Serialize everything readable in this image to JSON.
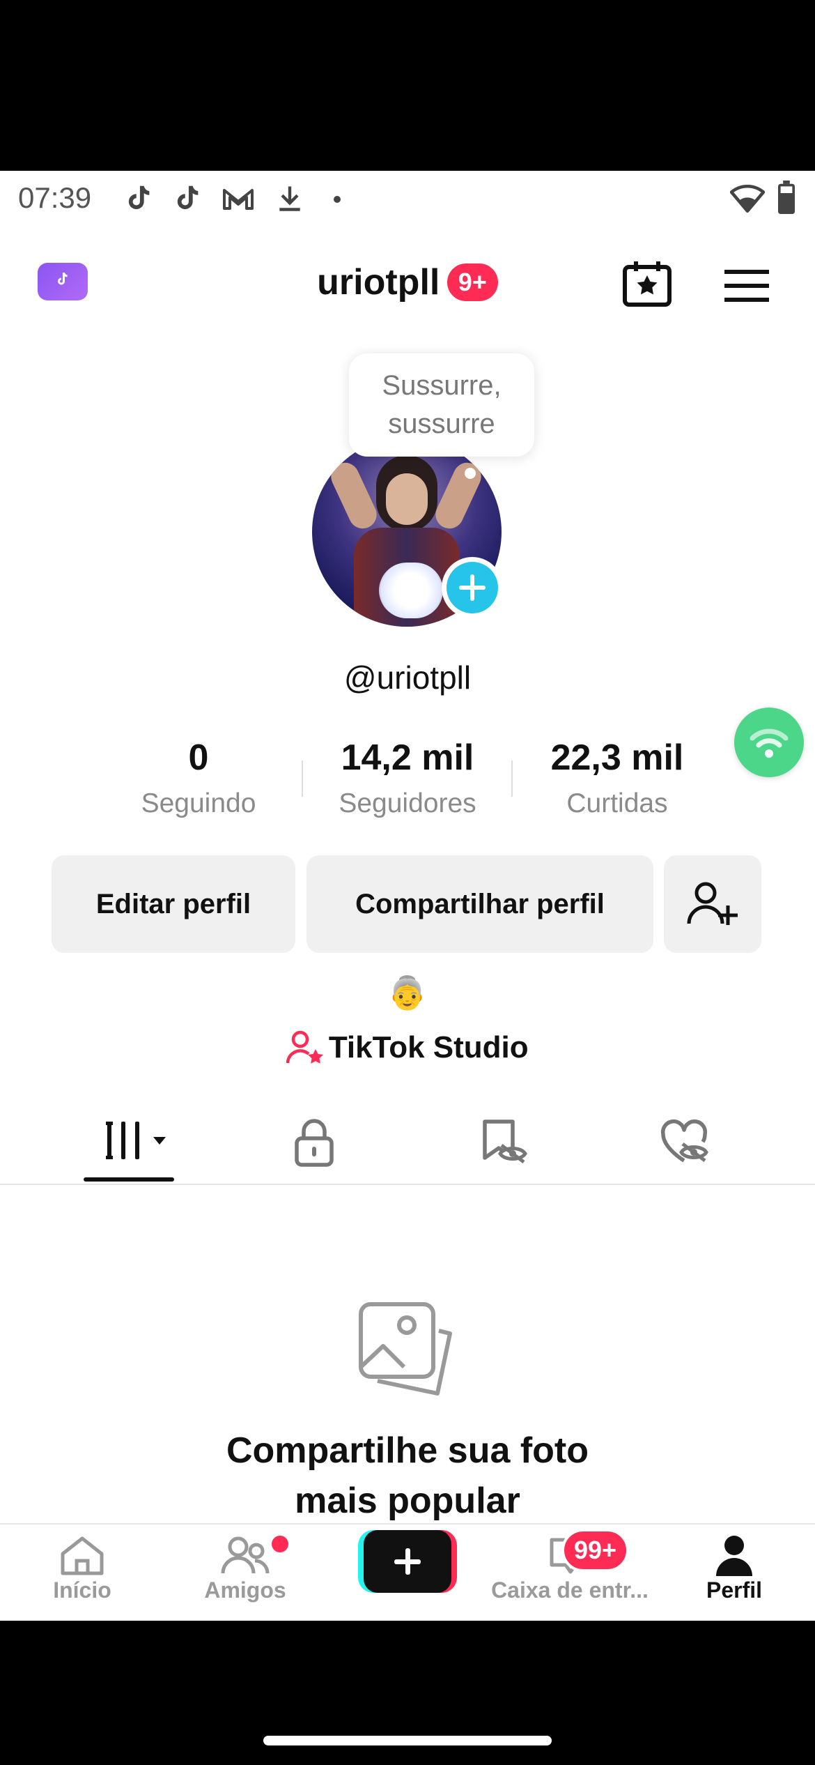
{
  "status_bar": {
    "time": "07:39"
  },
  "header": {
    "username": "uriotpll",
    "notif_badge": "9+"
  },
  "tooltip": {
    "line1": "Sussurre,",
    "line2": "sussurre"
  },
  "profile": {
    "handle": "@uriotpll"
  },
  "stats": [
    {
      "value": "0",
      "label": "Seguindo"
    },
    {
      "value": "14,2 mil",
      "label": "Seguidores"
    },
    {
      "value": "22,3 mil",
      "label": "Curtidas"
    }
  ],
  "buttons": {
    "edit": "Editar perfil",
    "share": "Compartilhar perfil"
  },
  "bio_emoji": "👵",
  "studio": {
    "label": "TikTok Studio"
  },
  "empty_state": {
    "line1": "Compartilhe sua foto",
    "line2": "mais popular"
  },
  "nav": {
    "home": "Início",
    "friends": "Amigos",
    "inbox": "Caixa de entr...",
    "inbox_badge": "99+",
    "profile": "Perfil"
  },
  "colors": {
    "accent_red": "#fe2c55",
    "accent_cyan": "#25c4e8",
    "wifi_green": "#4cd68a"
  }
}
